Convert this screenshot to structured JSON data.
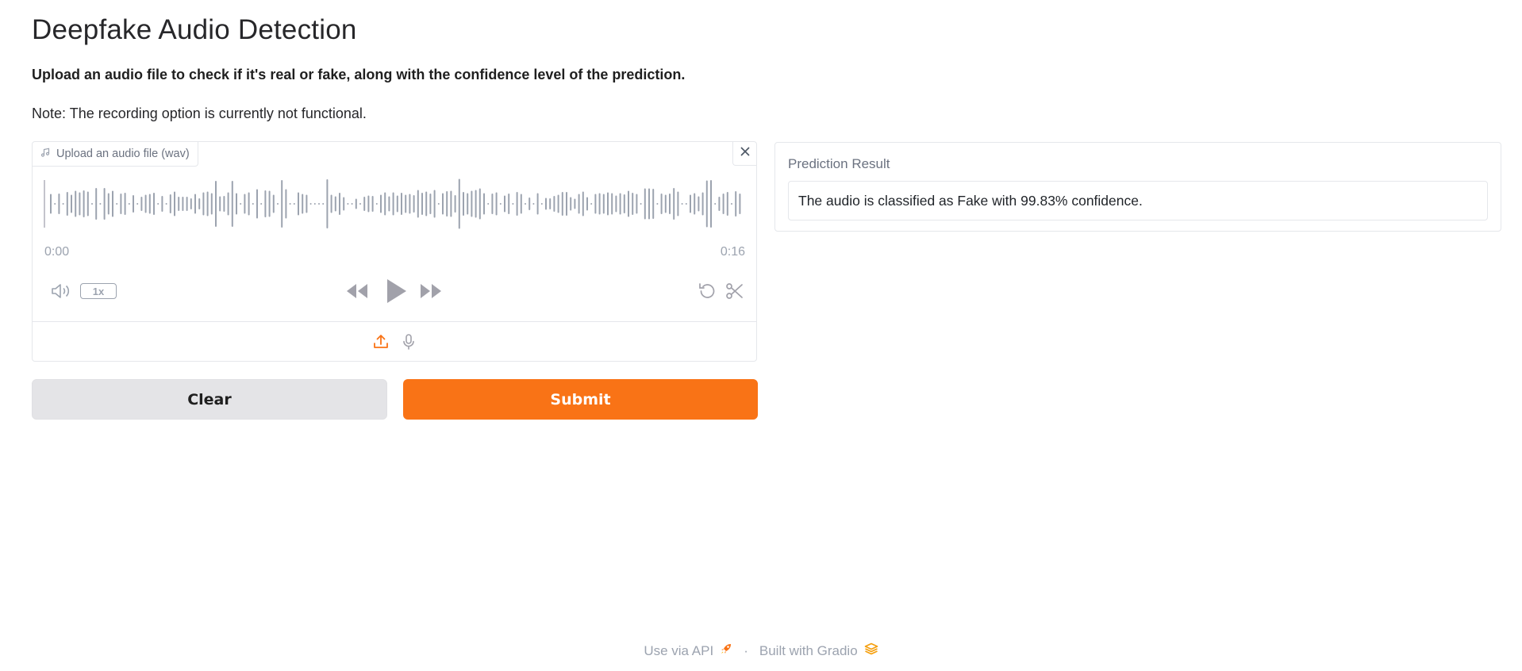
{
  "header": {
    "title": "Deepfake Audio Detection",
    "subtitle": "Upload an audio file to check if it's real or fake, along with the confidence level of the prediction.",
    "note": "Note: The recording option is currently not functional."
  },
  "audio_input": {
    "label": "Upload an audio file (wav)",
    "time_start": "0:00",
    "time_end": "0:16",
    "playback_speed": "1x",
    "icons": [
      "music-note-icon",
      "close-icon",
      "volume-icon",
      "rewind-icon",
      "play-icon",
      "forward-icon",
      "undo-icon",
      "scissors-icon",
      "upload-icon",
      "microphone-icon"
    ],
    "accent_color": "#f97316"
  },
  "actions": {
    "clear_label": "Clear",
    "submit_label": "Submit"
  },
  "output": {
    "label": "Prediction Result",
    "value": "The audio is classified as Fake with 99.83% confidence."
  },
  "footer": {
    "api_label": "Use via API",
    "separator": "·",
    "built_label": "Built with Gradio"
  },
  "colors": {
    "primary": "#f97316",
    "secondary_button": "#e4e4e7",
    "muted_text": "#9ca3af",
    "border": "#e5e7eb"
  }
}
